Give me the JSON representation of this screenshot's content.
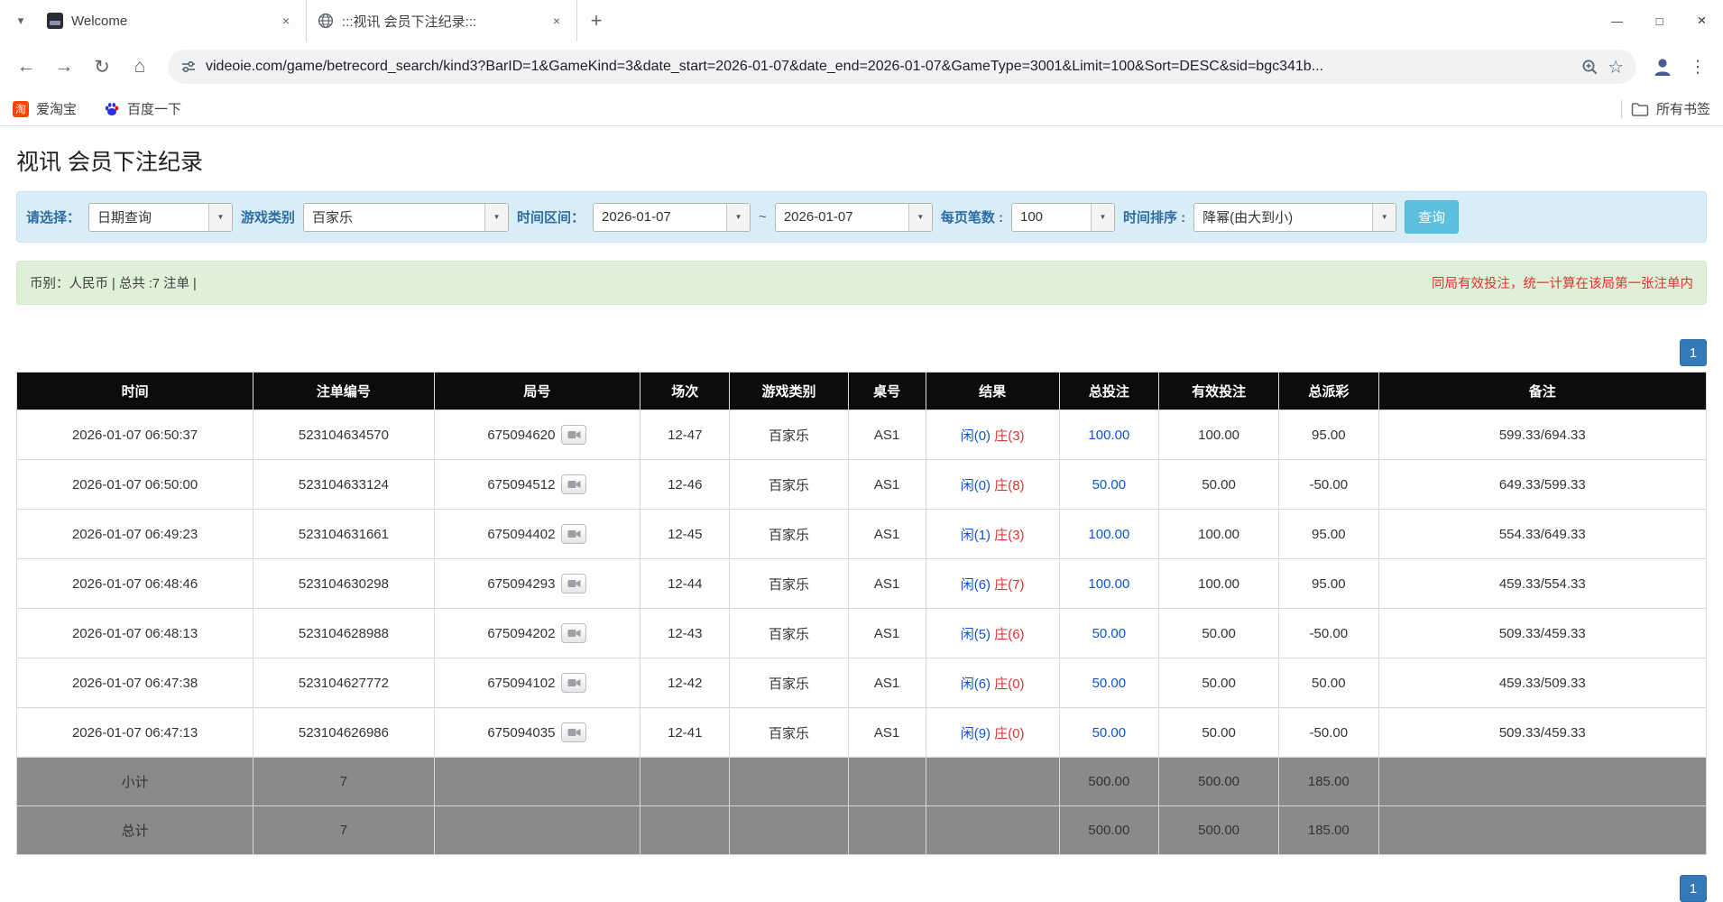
{
  "colors": {
    "accent_blue": "#1155cc",
    "danger_red": "#e03131",
    "filter_label_blue": "#2e6da4",
    "search_button_bg": "#5bc0de",
    "pagination_bg": "#337ab7",
    "table_header_bg": "#0c0c0c",
    "summary_row_bg": "#8a8a8a",
    "filter_bar_bg": "#d9edf7",
    "notice_bar_bg": "#dff0d8"
  },
  "icons": {
    "tab_search": "▾",
    "tab_close": "×",
    "new_tab": "+",
    "back": "←",
    "forward": "→",
    "refresh": "↻",
    "home": "⌂",
    "star": "☆",
    "menu": "⋮",
    "minimize": "—",
    "maximize": "□",
    "close": "×",
    "dropdown_arrow": "▼",
    "taobao_glyph": "淘"
  },
  "browser": {
    "tabs": [
      {
        "title": "Welcome"
      },
      {
        "title": ":::视讯 会员下注纪录:::"
      }
    ],
    "url": "videoie.com/game/betrecord_search/kind3?BarID=1&GameKind=3&date_start=2026-01-07&date_end=2026-01-07&GameType=3001&Limit=100&Sort=DESC&sid=bgc341b...",
    "bookmarks": [
      {
        "label": "爱淘宝"
      },
      {
        "label": "百度一下"
      }
    ],
    "all_bookmarks_label": "所有书签"
  },
  "page": {
    "title": "视讯 会员下注纪录",
    "filters": {
      "select_label": "请选择：",
      "select_value": "日期查询",
      "game_type_label": "游戏类别",
      "game_type_value": "百家乐",
      "date_range_label": "时间区间：",
      "date_start": "2026-01-07",
      "date_separator": "~",
      "date_end": "2026-01-07",
      "page_size_label": "每页笔数 :",
      "page_size_value": "100",
      "sort_label": "时间排序 :",
      "sort_value": "降幂(由大到小)",
      "search_button_label": "查询"
    },
    "notice": {
      "left": "币别：人民币 | 总共 :7 注单 |",
      "right": "同局有效投注，统一计算在该局第一张注单内"
    },
    "pagination": {
      "page": "1"
    },
    "table": {
      "headers": [
        "时间",
        "注单编号",
        "局号",
        "场次",
        "游戏类别",
        "桌号",
        "结果",
        "总投注",
        "有效投注",
        "总派彩",
        "备注"
      ],
      "rows": [
        {
          "time": "2026-01-07 06:50:37",
          "bet_id": "523104634570",
          "round": "675094620",
          "session": "12-47",
          "game": "百家乐",
          "table_no": "AS1",
          "result_player": "闲(0)",
          "result_banker": "庄(3)",
          "total_bet": "100.00",
          "valid_bet": "100.00",
          "payout": "95.00",
          "note": "599.33/694.33"
        },
        {
          "time": "2026-01-07 06:50:00",
          "bet_id": "523104633124",
          "round": "675094512",
          "session": "12-46",
          "game": "百家乐",
          "table_no": "AS1",
          "result_player": "闲(0)",
          "result_banker": "庄(8)",
          "total_bet": "50.00",
          "valid_bet": "50.00",
          "payout": "-50.00",
          "note": "649.33/599.33"
        },
        {
          "time": "2026-01-07 06:49:23",
          "bet_id": "523104631661",
          "round": "675094402",
          "session": "12-45",
          "game": "百家乐",
          "table_no": "AS1",
          "result_player": "闲(1)",
          "result_banker": "庄(3)",
          "total_bet": "100.00",
          "valid_bet": "100.00",
          "payout": "95.00",
          "note": "554.33/649.33"
        },
        {
          "time": "2026-01-07 06:48:46",
          "bet_id": "523104630298",
          "round": "675094293",
          "session": "12-44",
          "game": "百家乐",
          "table_no": "AS1",
          "result_player": "闲(6)",
          "result_banker": "庄(7)",
          "total_bet": "100.00",
          "valid_bet": "100.00",
          "payout": "95.00",
          "note": "459.33/554.33"
        },
        {
          "time": "2026-01-07 06:48:13",
          "bet_id": "523104628988",
          "round": "675094202",
          "session": "12-43",
          "game": "百家乐",
          "table_no": "AS1",
          "result_player": "闲(5)",
          "result_banker": "庄(6)",
          "total_bet": "50.00",
          "valid_bet": "50.00",
          "payout": "-50.00",
          "note": "509.33/459.33"
        },
        {
          "time": "2026-01-07 06:47:38",
          "bet_id": "523104627772",
          "round": "675094102",
          "session": "12-42",
          "game": "百家乐",
          "table_no": "AS1",
          "result_player": "闲(6)",
          "result_banker": "庄(0)",
          "total_bet": "50.00",
          "valid_bet": "50.00",
          "payout": "50.00",
          "note": "459.33/509.33"
        },
        {
          "time": "2026-01-07 06:47:13",
          "bet_id": "523104626986",
          "round": "675094035",
          "session": "12-41",
          "game": "百家乐",
          "table_no": "AS1",
          "result_player": "闲(9)",
          "result_banker": "庄(0)",
          "total_bet": "50.00",
          "valid_bet": "50.00",
          "payout": "-50.00",
          "note": "509.33/459.33"
        }
      ],
      "subtotal": {
        "label": "小计",
        "count": "7",
        "total_bet": "500.00",
        "valid_bet": "500.00",
        "payout": "185.00"
      },
      "total": {
        "label": "总计",
        "count": "7",
        "total_bet": "500.00",
        "valid_bet": "500.00",
        "payout": "185.00"
      }
    }
  }
}
